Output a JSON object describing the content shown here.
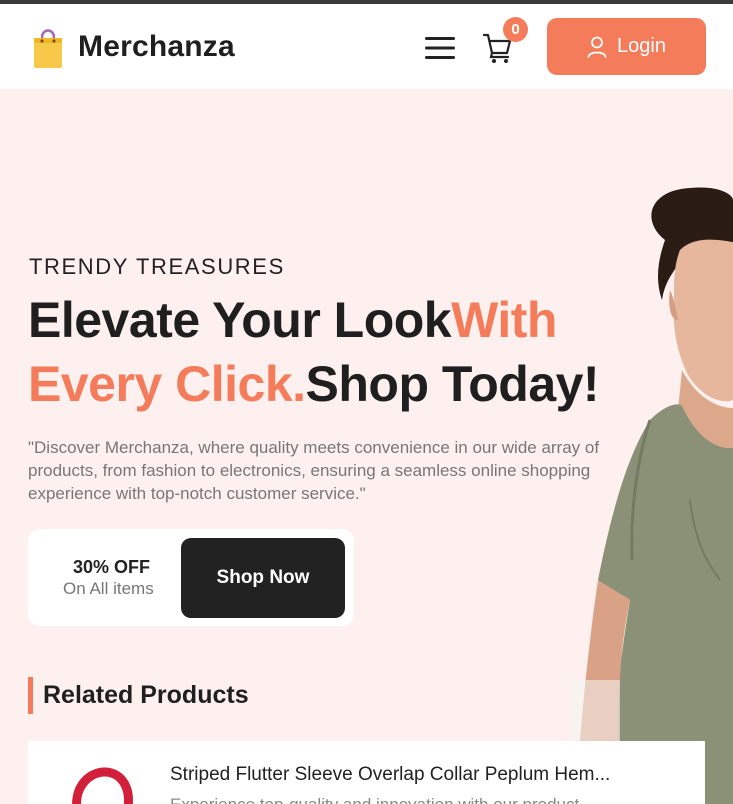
{
  "header": {
    "brand": "Merchanza",
    "cart_count": "0",
    "login_label": "Login",
    "icons": [
      "shopping-bag-icon",
      "menu-icon",
      "cart-icon",
      "user-icon"
    ]
  },
  "hero": {
    "eyebrow": "TRENDY TREASURES",
    "headline_part1": "Elevate Your Look",
    "headline_accent1": "With",
    "headline_accent2": "Every Click.",
    "headline_part2": "Shop Today!",
    "description": "\"Discover Merchanza, where quality meets convenience in our wide array of products, from fashion to electronics, ensuring a seamless online shopping experience with top-notch customer service.\"",
    "offer_title": "30% OFF",
    "offer_subtitle": "On All items",
    "shop_button": "Shop Now"
  },
  "related": {
    "title": "Related Products",
    "products": [
      {
        "name": "Striped Flutter Sleeve Overlap Collar Peplum Hem...",
        "description": "Experience top-quality and innovation with our product"
      }
    ]
  },
  "colors": {
    "accent": "#f47c5b",
    "dark": "#222222",
    "hero_bg": "#fdf0ee"
  }
}
